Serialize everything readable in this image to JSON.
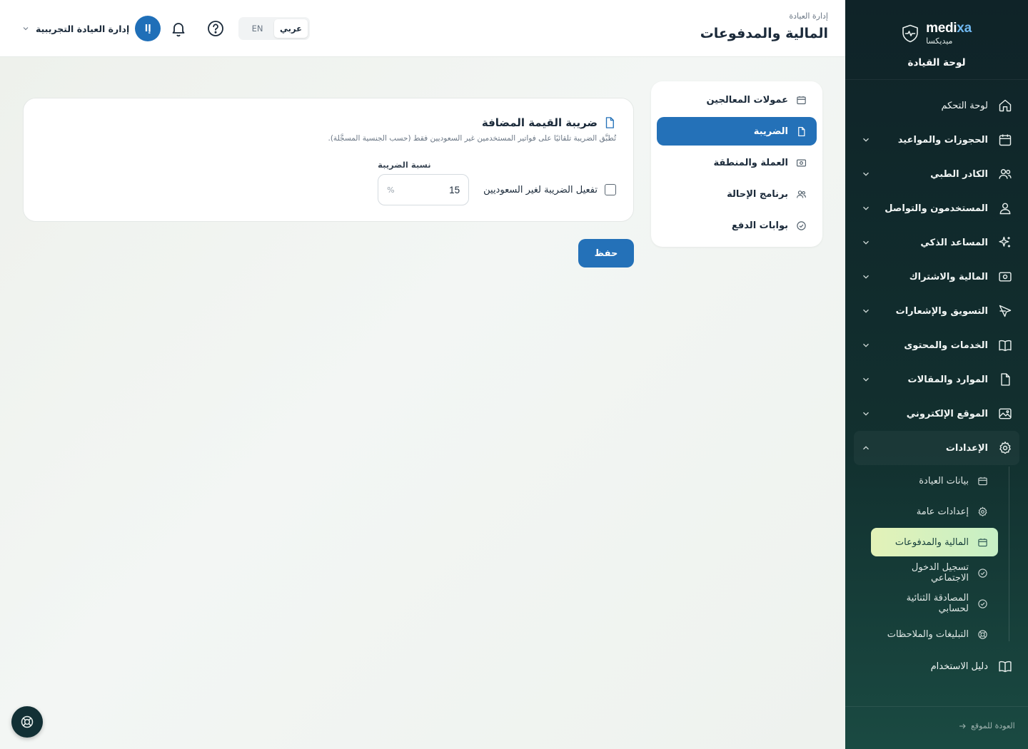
{
  "brand": {
    "name_a": "medi",
    "name_b": "xa",
    "sub": "ميديكسا",
    "title": "لوحة القيادة"
  },
  "sidebar": {
    "items": [
      {
        "label": "لوحة التحكم",
        "icon": "home-icon"
      },
      {
        "label": "الحجوزات والمواعيد",
        "icon": "calendar-icon"
      },
      {
        "label": "الكادر الطبي",
        "icon": "users-icon"
      },
      {
        "label": "المستخدمون والتواصل",
        "icon": "user-icon"
      },
      {
        "label": "المساعد الذكي",
        "icon": "sparkles-icon"
      },
      {
        "label": "المالية والاشتراك",
        "icon": "banknote-icon"
      },
      {
        "label": "التسويق والإشعارات",
        "icon": "send-icon"
      },
      {
        "label": "الخدمات والمحتوى",
        "icon": "book-icon"
      },
      {
        "label": "الموارد والمقالات",
        "icon": "file-icon"
      },
      {
        "label": "الموقع الإلكتروني",
        "icon": "image-icon"
      },
      {
        "label": "الإعدادات",
        "icon": "gear-icon"
      }
    ],
    "settings_sub": [
      {
        "label": "بيانات العيادة",
        "icon": "building-icon"
      },
      {
        "label": "إعدادات عامة",
        "icon": "gear-icon"
      },
      {
        "label": "المالية والمدفوعات",
        "icon": "wallet-icon"
      },
      {
        "label": "تسجيل الدخول الاجتماعي",
        "icon": "check-circle-icon"
      },
      {
        "label": "المصادقة الثنائية لحسابي",
        "icon": "check-circle-icon"
      },
      {
        "label": "التبليغات والملاحظات",
        "icon": "lifebuoy-icon"
      }
    ],
    "guide_label": "دليل الاستخدام",
    "back_label": "العودة للموقع"
  },
  "header": {
    "breadcrumb": "إدارة العيادة",
    "title": "المالية والمدفوعات",
    "lang_ar": "عربي",
    "lang_en": "EN",
    "user_initials": "إا",
    "user_name": "إدارة العيادة التجريبية"
  },
  "tabs": [
    {
      "label": "عمولات المعالجين",
      "icon": "wallet-icon"
    },
    {
      "label": "الضريبة",
      "icon": "file-icon"
    },
    {
      "label": "العملة والمنطقة",
      "icon": "banknote-icon"
    },
    {
      "label": "برنامج الإحالة",
      "icon": "users-icon"
    },
    {
      "label": "بوابات الدفع",
      "icon": "check-circle-icon"
    }
  ],
  "tax": {
    "title": "ضريبة القيمة المضافة",
    "description": "تُطبَّق الضريبة تلقائيًا على فواتير المستخدمين غير السعوديين فقط (حسب الجنسية المسجَّلة).",
    "enable_label": "تفعيل الضريبة لغير السعوديين",
    "enabled": false,
    "rate_label": "نسبة الضريبة",
    "rate_value": "15",
    "rate_unit": "%"
  },
  "save_label": "حفظ",
  "colors": {
    "primary": "#2471b8",
    "sidebar_bg": "#0f2328",
    "active_sub": "#d8f0bf"
  }
}
